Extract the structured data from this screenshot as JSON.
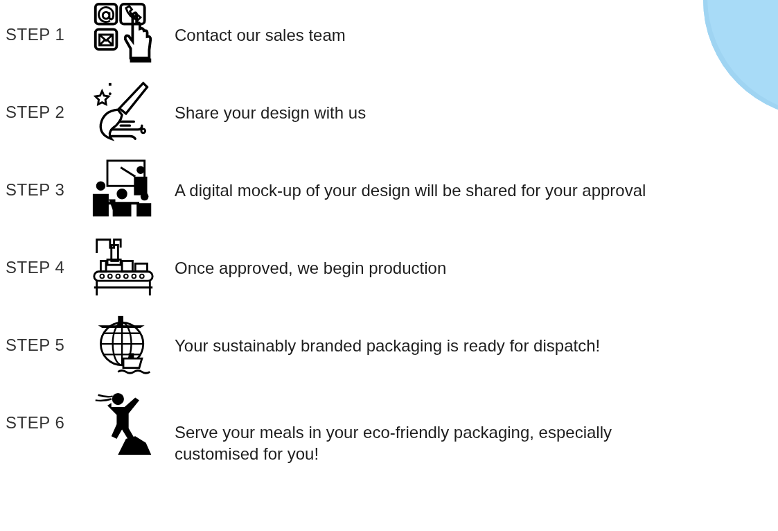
{
  "steps": [
    {
      "label": "STEP 1",
      "text": "Contact our sales team"
    },
    {
      "label": "STEP 2",
      "text": "Share your design with us"
    },
    {
      "label": "STEP 3",
      "text": "A digital mock-up of your design will be shared for your approval"
    },
    {
      "label": "STEP 4",
      "text": "Once approved, we begin production"
    },
    {
      "label": "STEP 5",
      "text": "Your sustainably branded packaging is ready for dispatch!"
    },
    {
      "label": "STEP 6",
      "text": "Serve your meals in your eco-friendly packaging, especially customised for you!"
    }
  ]
}
